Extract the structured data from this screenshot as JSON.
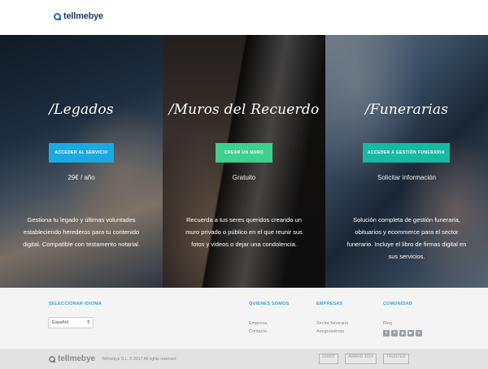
{
  "header": {
    "logo_text": "tellmebye"
  },
  "panels": [
    {
      "title": "/Legados",
      "button": "ACCEDER AL SERVICIO",
      "price": "29€ / año",
      "description": "Gestiona tu legado y últimas voluntades estableciendo herederos para tu contenido digital. Compatible con testamento notarial."
    },
    {
      "title": "/Muros del Recuerdo",
      "button": "CREAR UN MURO",
      "price": "Gratuito",
      "description": "Recuerda a tus seres queridos creando un muro privado o público en el que reunir sus fotos y videos o dejar una condolencia."
    },
    {
      "title": "/Funerarias",
      "button": "ACCEDER A GESTIÓN FUNERARIA",
      "price": "Solicitar información",
      "description": "Solución completa de gestión funeraria, obituarios y ecommerce para el sector funerario. Incluye el libro de firmas digital en sus servicios."
    }
  ],
  "footer": {
    "language_label": "SELECCIONAR IDIOMA",
    "language_value": "Español",
    "quienes_somos": {
      "title": "QUIENES SOMOS",
      "links": [
        "Empresa",
        "Contacto"
      ]
    },
    "empresas": {
      "title": "EMPRESAS",
      "links": [
        "Sector funerario",
        "Aseguradoras"
      ]
    },
    "comunidad": {
      "title": "COMUNIDAD",
      "links": [
        "Blog"
      ]
    },
    "social_icons": [
      "twitter-icon",
      "facebook-icon",
      "google-plus-icon",
      "youtube-icon",
      "vimeo-icon"
    ]
  },
  "bottom": {
    "logo_text": "tellmebye",
    "copyright": "Tellmebye S.L. © 2017 All rights reserved",
    "badges": [
      "256BIT",
      "AWARD 2014",
      "TRUSTED"
    ]
  },
  "colors": {
    "cta_legados": "#1ba9e1",
    "cta_muros": "#3fcf8e",
    "cta_funerarias": "#17b9a2",
    "footer_title": "#3aa3d8",
    "brand": "#1f6fb4"
  }
}
